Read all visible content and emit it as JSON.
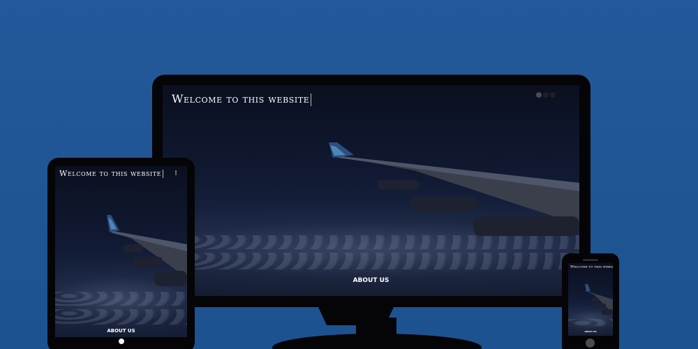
{
  "site": {
    "title": "Welcome to this website",
    "about_link": "ABOUT US"
  },
  "devices": [
    "monitor",
    "tablet",
    "phone"
  ],
  "colors": {
    "background": "#21579a",
    "device_frame": "#050507",
    "text": "#ffffff"
  },
  "icons": {
    "slider_dots": "slider-dot-icon",
    "home_button": "home-button-icon"
  }
}
